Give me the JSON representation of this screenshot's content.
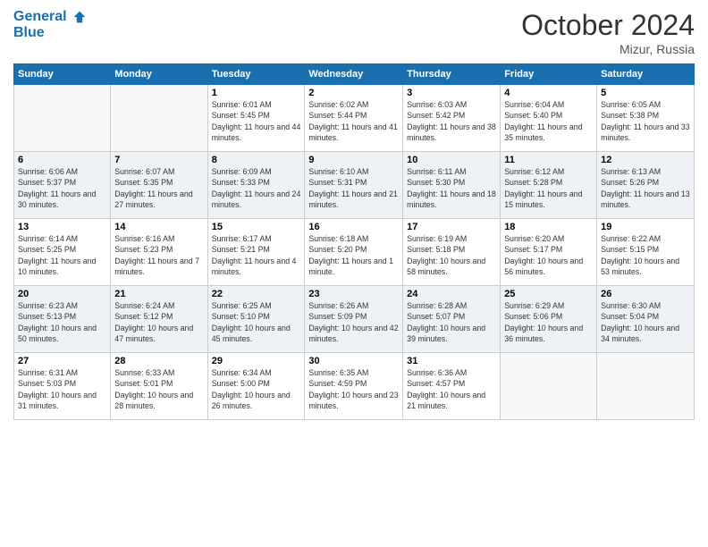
{
  "header": {
    "logo_line1": "General",
    "logo_line2": "Blue",
    "month": "October 2024",
    "location": "Mizur, Russia"
  },
  "weekdays": [
    "Sunday",
    "Monday",
    "Tuesday",
    "Wednesday",
    "Thursday",
    "Friday",
    "Saturday"
  ],
  "weeks": [
    [
      {
        "day": "",
        "info": ""
      },
      {
        "day": "",
        "info": ""
      },
      {
        "day": "1",
        "info": "Sunrise: 6:01 AM\nSunset: 5:45 PM\nDaylight: 11 hours and 44 minutes."
      },
      {
        "day": "2",
        "info": "Sunrise: 6:02 AM\nSunset: 5:44 PM\nDaylight: 11 hours and 41 minutes."
      },
      {
        "day": "3",
        "info": "Sunrise: 6:03 AM\nSunset: 5:42 PM\nDaylight: 11 hours and 38 minutes."
      },
      {
        "day": "4",
        "info": "Sunrise: 6:04 AM\nSunset: 5:40 PM\nDaylight: 11 hours and 35 minutes."
      },
      {
        "day": "5",
        "info": "Sunrise: 6:05 AM\nSunset: 5:38 PM\nDaylight: 11 hours and 33 minutes."
      }
    ],
    [
      {
        "day": "6",
        "info": "Sunrise: 6:06 AM\nSunset: 5:37 PM\nDaylight: 11 hours and 30 minutes."
      },
      {
        "day": "7",
        "info": "Sunrise: 6:07 AM\nSunset: 5:35 PM\nDaylight: 11 hours and 27 minutes."
      },
      {
        "day": "8",
        "info": "Sunrise: 6:09 AM\nSunset: 5:33 PM\nDaylight: 11 hours and 24 minutes."
      },
      {
        "day": "9",
        "info": "Sunrise: 6:10 AM\nSunset: 5:31 PM\nDaylight: 11 hours and 21 minutes."
      },
      {
        "day": "10",
        "info": "Sunrise: 6:11 AM\nSunset: 5:30 PM\nDaylight: 11 hours and 18 minutes."
      },
      {
        "day": "11",
        "info": "Sunrise: 6:12 AM\nSunset: 5:28 PM\nDaylight: 11 hours and 15 minutes."
      },
      {
        "day": "12",
        "info": "Sunrise: 6:13 AM\nSunset: 5:26 PM\nDaylight: 11 hours and 13 minutes."
      }
    ],
    [
      {
        "day": "13",
        "info": "Sunrise: 6:14 AM\nSunset: 5:25 PM\nDaylight: 11 hours and 10 minutes."
      },
      {
        "day": "14",
        "info": "Sunrise: 6:16 AM\nSunset: 5:23 PM\nDaylight: 11 hours and 7 minutes."
      },
      {
        "day": "15",
        "info": "Sunrise: 6:17 AM\nSunset: 5:21 PM\nDaylight: 11 hours and 4 minutes."
      },
      {
        "day": "16",
        "info": "Sunrise: 6:18 AM\nSunset: 5:20 PM\nDaylight: 11 hours and 1 minute."
      },
      {
        "day": "17",
        "info": "Sunrise: 6:19 AM\nSunset: 5:18 PM\nDaylight: 10 hours and 58 minutes."
      },
      {
        "day": "18",
        "info": "Sunrise: 6:20 AM\nSunset: 5:17 PM\nDaylight: 10 hours and 56 minutes."
      },
      {
        "day": "19",
        "info": "Sunrise: 6:22 AM\nSunset: 5:15 PM\nDaylight: 10 hours and 53 minutes."
      }
    ],
    [
      {
        "day": "20",
        "info": "Sunrise: 6:23 AM\nSunset: 5:13 PM\nDaylight: 10 hours and 50 minutes."
      },
      {
        "day": "21",
        "info": "Sunrise: 6:24 AM\nSunset: 5:12 PM\nDaylight: 10 hours and 47 minutes."
      },
      {
        "day": "22",
        "info": "Sunrise: 6:25 AM\nSunset: 5:10 PM\nDaylight: 10 hours and 45 minutes."
      },
      {
        "day": "23",
        "info": "Sunrise: 6:26 AM\nSunset: 5:09 PM\nDaylight: 10 hours and 42 minutes."
      },
      {
        "day": "24",
        "info": "Sunrise: 6:28 AM\nSunset: 5:07 PM\nDaylight: 10 hours and 39 minutes."
      },
      {
        "day": "25",
        "info": "Sunrise: 6:29 AM\nSunset: 5:06 PM\nDaylight: 10 hours and 36 minutes."
      },
      {
        "day": "26",
        "info": "Sunrise: 6:30 AM\nSunset: 5:04 PM\nDaylight: 10 hours and 34 minutes."
      }
    ],
    [
      {
        "day": "27",
        "info": "Sunrise: 6:31 AM\nSunset: 5:03 PM\nDaylight: 10 hours and 31 minutes."
      },
      {
        "day": "28",
        "info": "Sunrise: 6:33 AM\nSunset: 5:01 PM\nDaylight: 10 hours and 28 minutes."
      },
      {
        "day": "29",
        "info": "Sunrise: 6:34 AM\nSunset: 5:00 PM\nDaylight: 10 hours and 26 minutes."
      },
      {
        "day": "30",
        "info": "Sunrise: 6:35 AM\nSunset: 4:59 PM\nDaylight: 10 hours and 23 minutes."
      },
      {
        "day": "31",
        "info": "Sunrise: 6:36 AM\nSunset: 4:57 PM\nDaylight: 10 hours and 21 minutes."
      },
      {
        "day": "",
        "info": ""
      },
      {
        "day": "",
        "info": ""
      }
    ]
  ]
}
